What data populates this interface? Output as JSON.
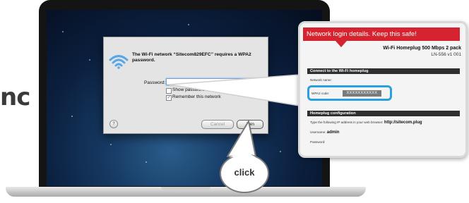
{
  "side_text": "nc",
  "dialog": {
    "message": "The Wi-Fi network “Sitecom829EFC” requires a WPA2 password.",
    "password_label": "Password:",
    "password_value": "",
    "show_password_label": "Show password",
    "show_password_checked": false,
    "remember_label": "Remember this network",
    "remember_checked": true,
    "help_label": "?",
    "cancel_label": "Cancel",
    "join_label": "Join"
  },
  "click_bubble": {
    "label": "click"
  },
  "label_card": {
    "banner": "Network login details. Keep this safe!",
    "product": "Wi-Fi Homeplug 500 Mbps 2 pack",
    "model": "LN-556 v1 001",
    "section1_title": "Connect to the Wi-Fi homeplug",
    "network_name_label": "Network name:",
    "wpa2_label": "WPA2 code:",
    "wpa2_code": "XXXXXXXXXXX",
    "section2_title": "Homeplug configuration",
    "ip_instruction": "Type the following IP address in your web browser:",
    "ip_url": "http://sitecom.plug",
    "username_label": "Username:",
    "username_value": "admin",
    "password_label": "Password:"
  },
  "colors": {
    "banner": "#d5242f",
    "highlight_ring": "#2aa0e0",
    "desktop": "#0b1f3e"
  }
}
